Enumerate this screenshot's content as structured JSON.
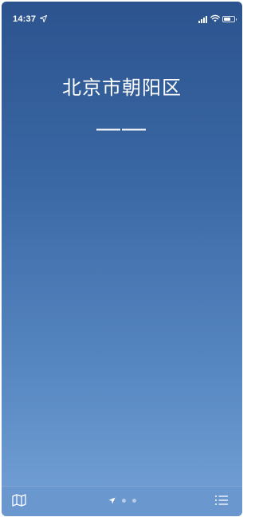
{
  "status_bar": {
    "time": "14:37",
    "location_icon": "location-arrow-icon",
    "signal_icon": "cellular-signal-icon",
    "wifi_icon": "wifi-icon",
    "battery_icon": "battery-icon"
  },
  "weather": {
    "location": "北京市朝阳区",
    "temperature": "——"
  },
  "toolbar": {
    "map_icon": "map-icon",
    "list_icon": "list-icon",
    "pages": [
      "current-location",
      "page-2",
      "page-3"
    ],
    "active_page": 0
  },
  "colors": {
    "gradient_top": "#2c538e",
    "gradient_bottom": "#74a2d7",
    "toolbar": "#6996cd",
    "text": "#ffffff"
  }
}
